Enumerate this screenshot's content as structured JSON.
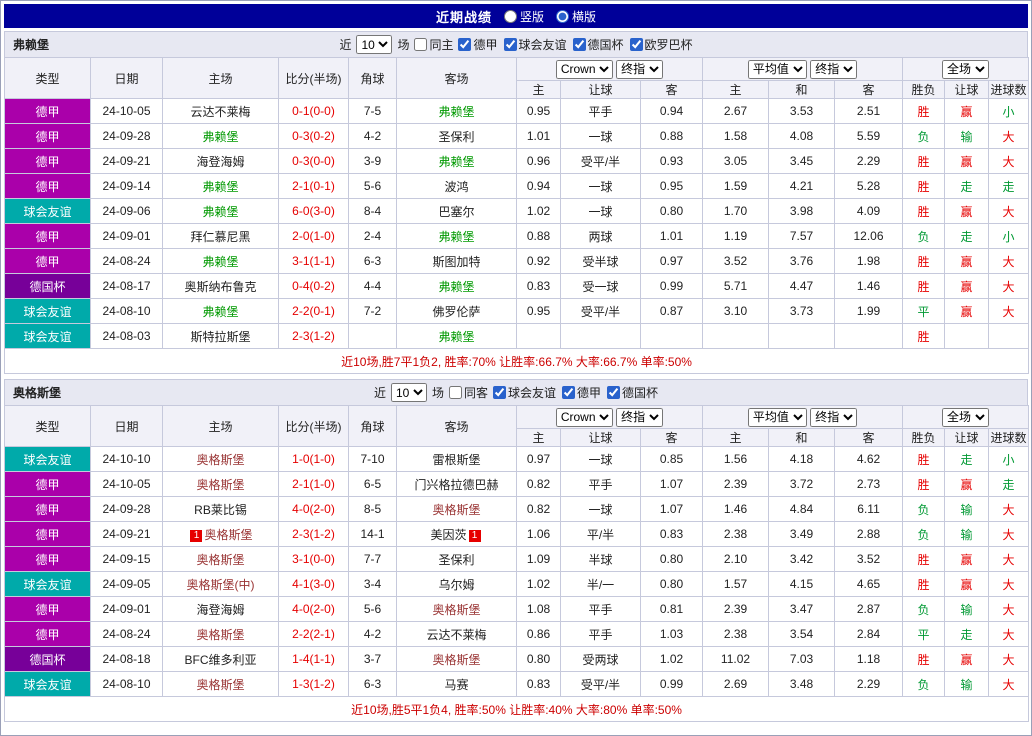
{
  "header": {
    "title": "近期战绩",
    "layout_options": [
      {
        "label": "竖版",
        "selected": false
      },
      {
        "label": "横版",
        "selected": true
      }
    ]
  },
  "colors": {
    "topbar_bg": "#000099",
    "leagues": {
      "德甲": "#aa00aa",
      "球会友谊": "#00aaaa",
      "德国杯": "#770099"
    },
    "score": "#e60000",
    "result_positive": "#e60000",
    "result_negative": "#009933",
    "summary_text": "#cc0000"
  },
  "table_columns": [
    "类型",
    "日期",
    "主场",
    "比分(半场)",
    "角球",
    "客场"
  ],
  "sub_columns": [
    "主",
    "让球",
    "客",
    "主",
    "和",
    "客",
    "胜负",
    "让球",
    "进球数"
  ],
  "sections": [
    {
      "team": "弗赖堡",
      "team_color": "#009900",
      "filter": {
        "recent_label": "近",
        "recent_value": "10",
        "recent_suffix": "场",
        "same_venue_label": "同主",
        "same_venue_checked": false,
        "leagues": [
          {
            "label": "德甲",
            "checked": true
          },
          {
            "label": "球会友谊",
            "checked": true
          },
          {
            "label": "德国杯",
            "checked": true
          },
          {
            "label": "欧罗巴杯",
            "checked": true
          }
        ]
      },
      "selects": {
        "odds_provider": "Crown",
        "odds_stage": "终指",
        "avg_label": "平均值",
        "avg_stage": "终指",
        "scope": "全场"
      },
      "rows": [
        {
          "league": "德甲",
          "date": "24-10-05",
          "home": "云达不莱梅",
          "home_hl": false,
          "score": "0-1(0-0)",
          "corners": "7-5",
          "away": "弗赖堡",
          "away_hl": true,
          "odds": [
            "0.95",
            "平手",
            "0.94"
          ],
          "avg": [
            "2.67",
            "3.53",
            "2.51"
          ],
          "results": [
            [
              "胜",
              "pos"
            ],
            [
              "赢",
              "pos"
            ],
            [
              "小",
              "neg"
            ]
          ]
        },
        {
          "league": "德甲",
          "date": "24-09-28",
          "home": "弗赖堡",
          "home_hl": true,
          "score": "0-3(0-2)",
          "corners": "4-2",
          "away": "圣保利",
          "away_hl": false,
          "odds": [
            "1.01",
            "一球",
            "0.88"
          ],
          "avg": [
            "1.58",
            "4.08",
            "5.59"
          ],
          "results": [
            [
              "负",
              "neg"
            ],
            [
              "输",
              "neg"
            ],
            [
              "大",
              "pos"
            ]
          ]
        },
        {
          "league": "德甲",
          "date": "24-09-21",
          "home": "海登海姆",
          "home_hl": false,
          "score": "0-3(0-0)",
          "corners": "3-9",
          "away": "弗赖堡",
          "away_hl": true,
          "odds": [
            "0.96",
            "受平/半",
            "0.93"
          ],
          "avg": [
            "3.05",
            "3.45",
            "2.29"
          ],
          "results": [
            [
              "胜",
              "pos"
            ],
            [
              "赢",
              "pos"
            ],
            [
              "大",
              "pos"
            ]
          ]
        },
        {
          "league": "德甲",
          "date": "24-09-14",
          "home": "弗赖堡",
          "home_hl": true,
          "score": "2-1(0-1)",
          "corners": "5-6",
          "away": "波鸿",
          "away_hl": false,
          "odds": [
            "0.94",
            "一球",
            "0.95"
          ],
          "avg": [
            "1.59",
            "4.21",
            "5.28"
          ],
          "results": [
            [
              "胜",
              "pos"
            ],
            [
              "走",
              "neg"
            ],
            [
              "走",
              "neg"
            ]
          ]
        },
        {
          "league": "球会友谊",
          "date": "24-09-06",
          "home": "弗赖堡",
          "home_hl": true,
          "score": "6-0(3-0)",
          "corners": "8-4",
          "away": "巴塞尔",
          "away_hl": false,
          "odds": [
            "1.02",
            "一球",
            "0.80"
          ],
          "avg": [
            "1.70",
            "3.98",
            "4.09"
          ],
          "results": [
            [
              "胜",
              "pos"
            ],
            [
              "赢",
              "pos"
            ],
            [
              "大",
              "pos"
            ]
          ]
        },
        {
          "league": "德甲",
          "date": "24-09-01",
          "home": "拜仁慕尼黑",
          "home_hl": false,
          "score": "2-0(1-0)",
          "corners": "2-4",
          "away": "弗赖堡",
          "away_hl": true,
          "odds": [
            "0.88",
            "两球",
            "1.01"
          ],
          "avg": [
            "1.19",
            "7.57",
            "12.06"
          ],
          "results": [
            [
              "负",
              "neg"
            ],
            [
              "走",
              "neg"
            ],
            [
              "小",
              "neg"
            ]
          ]
        },
        {
          "league": "德甲",
          "date": "24-08-24",
          "home": "弗赖堡",
          "home_hl": true,
          "score": "3-1(1-1)",
          "corners": "6-3",
          "away": "斯图加特",
          "away_hl": false,
          "odds": [
            "0.92",
            "受半球",
            "0.97"
          ],
          "avg": [
            "3.52",
            "3.76",
            "1.98"
          ],
          "results": [
            [
              "胜",
              "pos"
            ],
            [
              "赢",
              "pos"
            ],
            [
              "大",
              "pos"
            ]
          ]
        },
        {
          "league": "德国杯",
          "date": "24-08-17",
          "home": "奥斯纳布鲁克",
          "home_hl": false,
          "score": "0-4(0-2)",
          "corners": "4-4",
          "away": "弗赖堡",
          "away_hl": true,
          "odds": [
            "0.83",
            "受一球",
            "0.99"
          ],
          "avg": [
            "5.71",
            "4.47",
            "1.46"
          ],
          "results": [
            [
              "胜",
              "pos"
            ],
            [
              "赢",
              "pos"
            ],
            [
              "大",
              "pos"
            ]
          ]
        },
        {
          "league": "球会友谊",
          "date": "24-08-10",
          "home": "弗赖堡",
          "home_hl": true,
          "score": "2-2(0-1)",
          "corners": "7-2",
          "away": "佛罗伦萨",
          "away_hl": false,
          "odds": [
            "0.95",
            "受平/半",
            "0.87"
          ],
          "avg": [
            "3.10",
            "3.73",
            "1.99"
          ],
          "results": [
            [
              "平",
              "neg"
            ],
            [
              "赢",
              "pos"
            ],
            [
              "大",
              "pos"
            ]
          ]
        },
        {
          "league": "球会友谊",
          "date": "24-08-03",
          "home": "斯特拉斯堡",
          "home_hl": false,
          "score": "2-3(1-2)",
          "corners": "",
          "away": "弗赖堡",
          "away_hl": true,
          "odds": [
            "",
            "",
            ""
          ],
          "avg": [
            "",
            "",
            ""
          ],
          "results": [
            [
              "胜",
              "pos"
            ],
            [
              "",
              ""
            ],
            [
              "",
              ""
            ]
          ]
        }
      ],
      "summary": "近10场,胜7平1负2, 胜率:70% 让胜率:66.7% 大率:66.7% 单率:50%"
    },
    {
      "team": "奥格斯堡",
      "team_color": "#993333",
      "filter": {
        "recent_label": "近",
        "recent_value": "10",
        "recent_suffix": "场",
        "same_venue_label": "同客",
        "same_venue_checked": false,
        "leagues": [
          {
            "label": "球会友谊",
            "checked": true
          },
          {
            "label": "德甲",
            "checked": true
          },
          {
            "label": "德国杯",
            "checked": true
          }
        ]
      },
      "selects": {
        "odds_provider": "Crown",
        "odds_stage": "终指",
        "avg_label": "平均值",
        "avg_stage": "终指",
        "scope": "全场"
      },
      "rows": [
        {
          "league": "球会友谊",
          "date": "24-10-10",
          "home": "奥格斯堡",
          "home_hl": true,
          "score": "1-0(1-0)",
          "corners": "7-10",
          "away": "雷根斯堡",
          "away_hl": false,
          "odds": [
            "0.97",
            "一球",
            "0.85"
          ],
          "avg": [
            "1.56",
            "4.18",
            "4.62"
          ],
          "results": [
            [
              "胜",
              "pos"
            ],
            [
              "走",
              "neg"
            ],
            [
              "小",
              "neg"
            ]
          ]
        },
        {
          "league": "德甲",
          "date": "24-10-05",
          "home": "奥格斯堡",
          "home_hl": true,
          "score": "2-1(1-0)",
          "corners": "6-5",
          "away": "门兴格拉德巴赫",
          "away_hl": false,
          "odds": [
            "0.82",
            "平手",
            "1.07"
          ],
          "avg": [
            "2.39",
            "3.72",
            "2.73"
          ],
          "results": [
            [
              "胜",
              "pos"
            ],
            [
              "赢",
              "pos"
            ],
            [
              "走",
              "neg"
            ]
          ]
        },
        {
          "league": "德甲",
          "date": "24-09-28",
          "home": "RB莱比锡",
          "home_hl": false,
          "score": "4-0(2-0)",
          "corners": "8-5",
          "away": "奥格斯堡",
          "away_hl": true,
          "odds": [
            "0.82",
            "一球",
            "1.07"
          ],
          "avg": [
            "1.46",
            "4.84",
            "6.11"
          ],
          "results": [
            [
              "负",
              "neg"
            ],
            [
              "输",
              "neg"
            ],
            [
              "大",
              "pos"
            ]
          ]
        },
        {
          "league": "德甲",
          "date": "24-09-21",
          "home": "奥格斯堡",
          "home_hl": true,
          "home_badge": "1",
          "score": "2-3(1-2)",
          "corners": "14-1",
          "away": "美因茨",
          "away_hl": false,
          "away_badge": "1",
          "odds": [
            "1.06",
            "平/半",
            "0.83"
          ],
          "avg": [
            "2.38",
            "3.49",
            "2.88"
          ],
          "results": [
            [
              "负",
              "neg"
            ],
            [
              "输",
              "neg"
            ],
            [
              "大",
              "pos"
            ]
          ]
        },
        {
          "league": "德甲",
          "date": "24-09-15",
          "home": "奥格斯堡",
          "home_hl": true,
          "score": "3-1(0-0)",
          "corners": "7-7",
          "away": "圣保利",
          "away_hl": false,
          "odds": [
            "1.09",
            "半球",
            "0.80"
          ],
          "avg": [
            "2.10",
            "3.42",
            "3.52"
          ],
          "results": [
            [
              "胜",
              "pos"
            ],
            [
              "赢",
              "pos"
            ],
            [
              "大",
              "pos"
            ]
          ]
        },
        {
          "league": "球会友谊",
          "date": "24-09-05",
          "home": "奥格斯堡(中)",
          "home_hl": true,
          "score": "4-1(3-0)",
          "corners": "3-4",
          "away": "乌尔姆",
          "away_hl": false,
          "odds": [
            "1.02",
            "半/一",
            "0.80"
          ],
          "avg": [
            "1.57",
            "4.15",
            "4.65"
          ],
          "results": [
            [
              "胜",
              "pos"
            ],
            [
              "赢",
              "pos"
            ],
            [
              "大",
              "pos"
            ]
          ]
        },
        {
          "league": "德甲",
          "date": "24-09-01",
          "home": "海登海姆",
          "home_hl": false,
          "score": "4-0(2-0)",
          "corners": "5-6",
          "away": "奥格斯堡",
          "away_hl": true,
          "odds": [
            "1.08",
            "平手",
            "0.81"
          ],
          "avg": [
            "2.39",
            "3.47",
            "2.87"
          ],
          "results": [
            [
              "负",
              "neg"
            ],
            [
              "输",
              "neg"
            ],
            [
              "大",
              "pos"
            ]
          ]
        },
        {
          "league": "德甲",
          "date": "24-08-24",
          "home": "奥格斯堡",
          "home_hl": true,
          "score": "2-2(2-1)",
          "corners": "4-2",
          "away": "云达不莱梅",
          "away_hl": false,
          "odds": [
            "0.86",
            "平手",
            "1.03"
          ],
          "avg": [
            "2.38",
            "3.54",
            "2.84"
          ],
          "results": [
            [
              "平",
              "neg"
            ],
            [
              "走",
              "neg"
            ],
            [
              "大",
              "pos"
            ]
          ]
        },
        {
          "league": "德国杯",
          "date": "24-08-18",
          "home": "BFC维多利亚",
          "home_hl": false,
          "score": "1-4(1-1)",
          "corners": "3-7",
          "away": "奥格斯堡",
          "away_hl": true,
          "odds": [
            "0.80",
            "受两球",
            "1.02"
          ],
          "avg": [
            "11.02",
            "7.03",
            "1.18"
          ],
          "results": [
            [
              "胜",
              "pos"
            ],
            [
              "赢",
              "pos"
            ],
            [
              "大",
              "pos"
            ]
          ]
        },
        {
          "league": "球会友谊",
          "date": "24-08-10",
          "home": "奥格斯堡",
          "home_hl": true,
          "score": "1-3(1-2)",
          "corners": "6-3",
          "away": "马赛",
          "away_hl": false,
          "odds": [
            "0.83",
            "受平/半",
            "0.99"
          ],
          "avg": [
            "2.69",
            "3.48",
            "2.29"
          ],
          "results": [
            [
              "负",
              "neg"
            ],
            [
              "输",
              "neg"
            ],
            [
              "大",
              "pos"
            ]
          ]
        }
      ],
      "summary": "近10场,胜5平1负4, 胜率:50% 让胜率:40% 大率:80% 单率:50%"
    }
  ]
}
